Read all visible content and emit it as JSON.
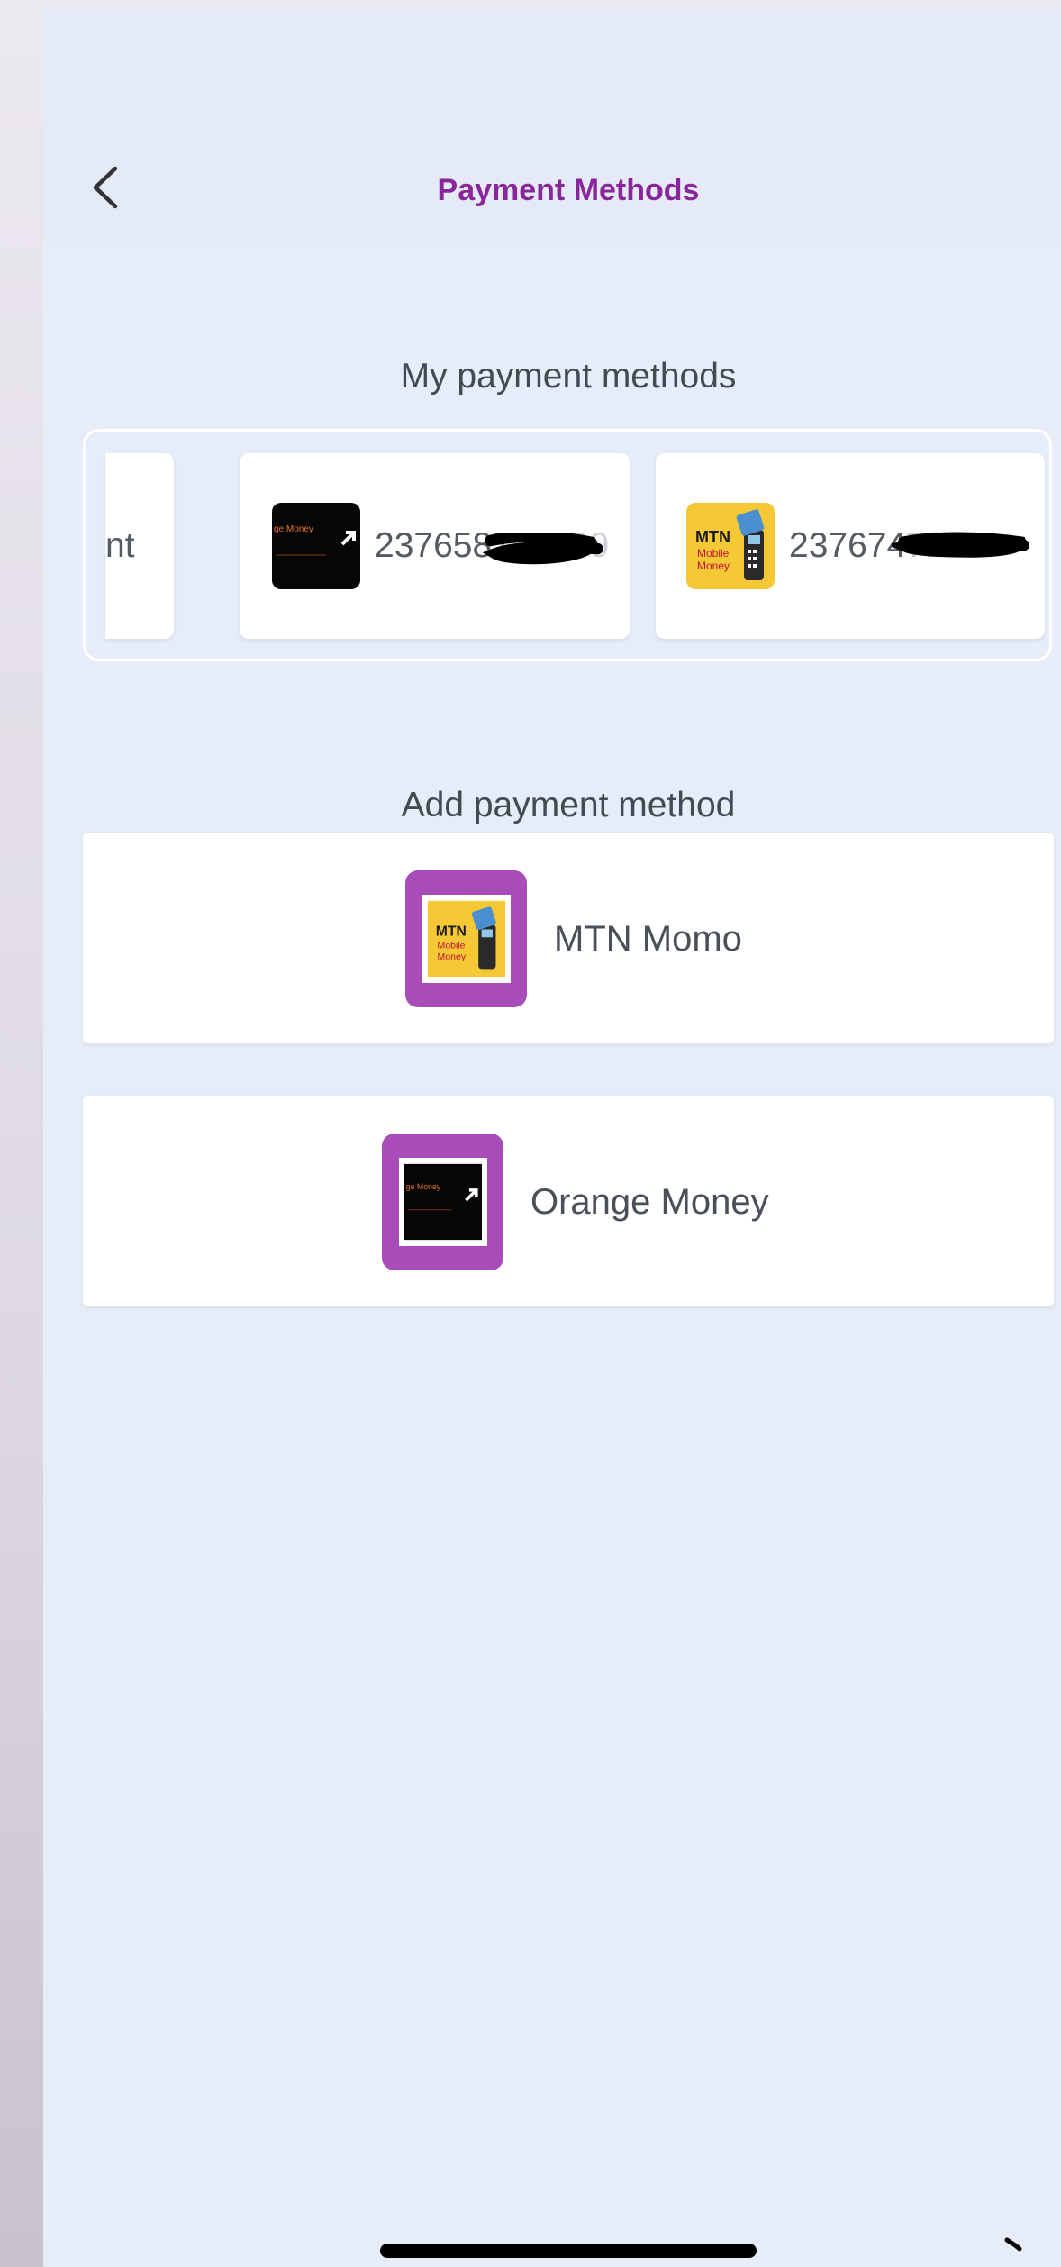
{
  "header": {
    "title": "Payment Methods"
  },
  "my_methods": {
    "title": "My payment methods",
    "cards": [
      {
        "partial_text": "nt",
        "provider": "orange-money"
      },
      {
        "provider": "orange-money",
        "number": "237658",
        "logo_text": "ge Money"
      },
      {
        "provider": "mtn-momo",
        "number": "237674",
        "logo_text": [
          "MTN",
          "Mobile",
          "Money"
        ]
      }
    ]
  },
  "add_methods": {
    "title": "Add payment method",
    "options": [
      {
        "label": "MTN Momo",
        "icon": "mtn-mobile-money-logo"
      },
      {
        "label": "Orange Money",
        "icon": "orange-money-logo"
      }
    ]
  },
  "colors": {
    "brand_purple": "#8a269c",
    "logo_frame": "#a84db7",
    "background": "#e7edf8",
    "mtn_yellow": "#f4c935"
  }
}
